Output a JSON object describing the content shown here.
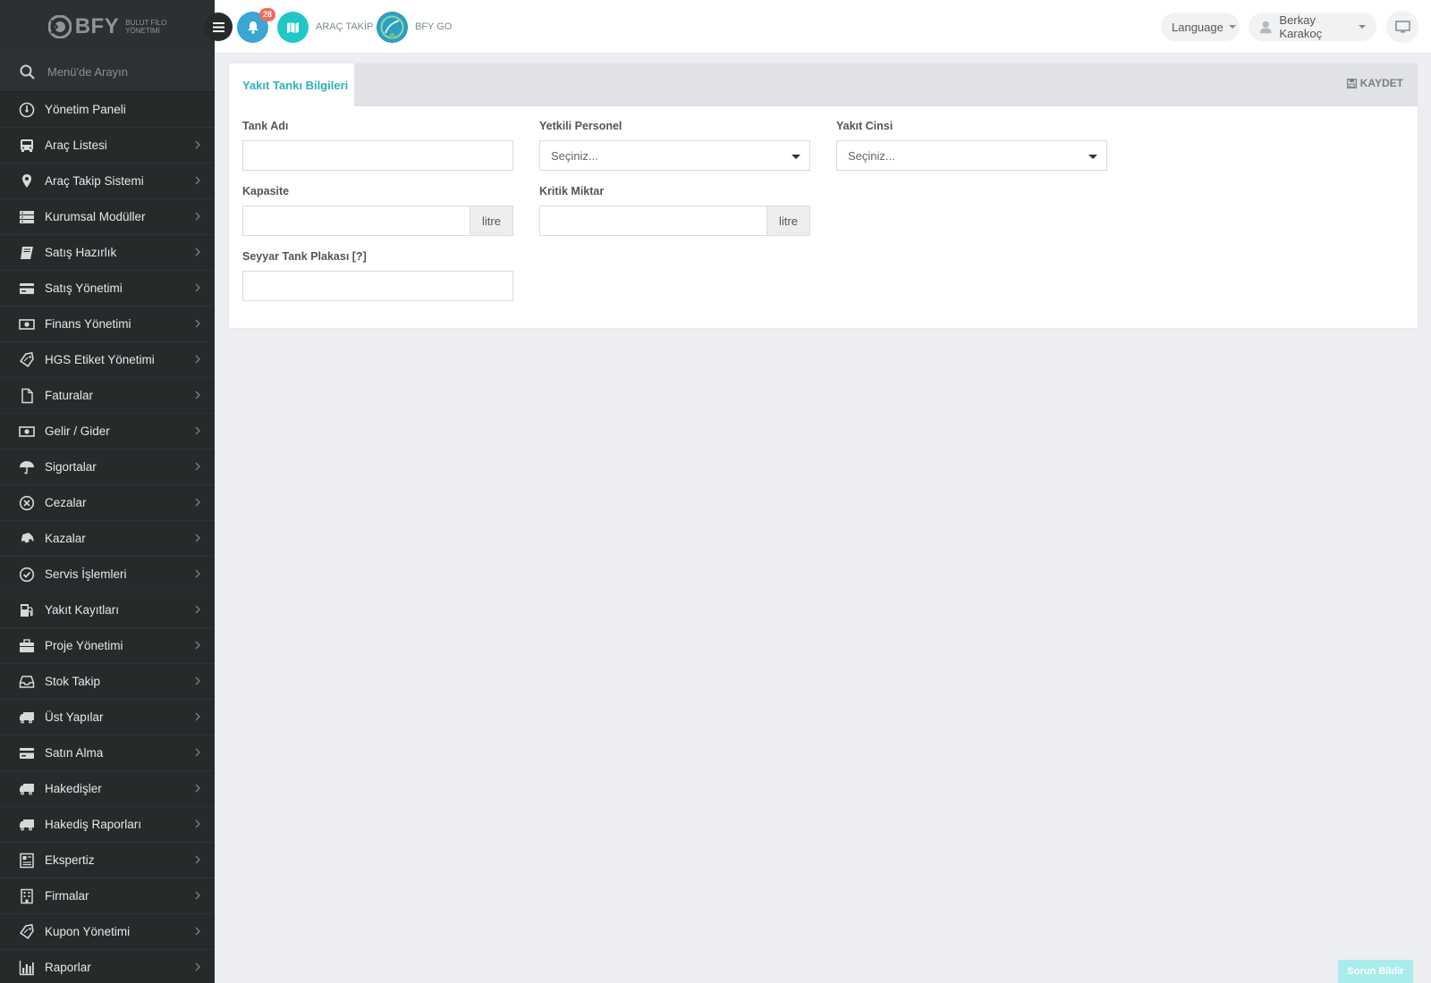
{
  "brand": {
    "name": "BFY",
    "subtitle_line1": "BULUT FİLO",
    "subtitle_line2": "YÖNETİMİ"
  },
  "sidebar": {
    "search_placeholder": "Menü'de Arayın",
    "items": [
      {
        "label": "Yönetim Paneli",
        "icon": "dashboard-icon",
        "chevron": false
      },
      {
        "label": "Araç Listesi",
        "icon": "bus-icon",
        "chevron": true
      },
      {
        "label": "Araç Takip Sistemi",
        "icon": "map-pin-icon",
        "chevron": true
      },
      {
        "label": "Kurumsal Modüller",
        "icon": "server-icon",
        "chevron": true
      },
      {
        "label": "Satış Hazırlık",
        "icon": "book-icon",
        "chevron": true
      },
      {
        "label": "Satış Yönetimi",
        "icon": "card-icon",
        "chevron": true
      },
      {
        "label": "Finans Yönetimi",
        "icon": "money-icon",
        "chevron": true
      },
      {
        "label": "HGS Etiket Yönetimi",
        "icon": "tag-icon",
        "chevron": true
      },
      {
        "label": "Faturalar",
        "icon": "file-icon",
        "chevron": true
      },
      {
        "label": "Gelir / Gider",
        "icon": "money-icon",
        "chevron": true
      },
      {
        "label": "Sigortalar",
        "icon": "umbrella-icon",
        "chevron": true
      },
      {
        "label": "Cezalar",
        "icon": "x-circle-icon",
        "chevron": true
      },
      {
        "label": "Kazalar",
        "icon": "car-crash-icon",
        "chevron": true
      },
      {
        "label": "Servis İşlemleri",
        "icon": "check-circle-icon",
        "chevron": true
      },
      {
        "label": "Yakıt Kayıtları",
        "icon": "fuel-pump-icon",
        "chevron": true
      },
      {
        "label": "Proje Yönetimi",
        "icon": "briefcase-icon",
        "chevron": true
      },
      {
        "label": "Stok Takip",
        "icon": "inbox-icon",
        "chevron": true
      },
      {
        "label": "Üst Yapılar",
        "icon": "truck-icon",
        "chevron": true
      },
      {
        "label": "Satın Alma",
        "icon": "card-icon",
        "chevron": true
      },
      {
        "label": "Hakedişler",
        "icon": "truck-icon",
        "chevron": true
      },
      {
        "label": "Hakediş Raporları",
        "icon": "truck-icon",
        "chevron": true
      },
      {
        "label": "Ekspertiz",
        "icon": "report-icon",
        "chevron": true
      },
      {
        "label": "Firmalar",
        "icon": "building-icon",
        "chevron": true
      },
      {
        "label": "Kupon Yönetimi",
        "icon": "tag-icon",
        "chevron": true
      },
      {
        "label": "Raporlar",
        "icon": "bar-chart-icon",
        "chevron": true
      }
    ]
  },
  "topbar": {
    "notification_count": "28",
    "arac_takip_label": "ARAÇ TAKİP",
    "bfy_go_label": "BFY GO",
    "language_label": "Language",
    "user_name": "Berkay Karakoç"
  },
  "panel": {
    "tab_label": "Yakıt Tankı Bilgileri",
    "save_label": "KAYDET",
    "fields": {
      "tank_name_label": "Tank Adı",
      "tank_name_value": "",
      "personnel_label": "Yetkili Personel",
      "personnel_value": "Seçiniz...",
      "fuel_type_label": "Yakıt Cinsi",
      "fuel_type_value": "Seçiniz...",
      "capacity_label": "Kapasite",
      "capacity_value": "",
      "capacity_unit": "litre",
      "critical_label": "Kritik Miktar",
      "critical_value": "",
      "critical_unit": "litre",
      "plate_label": "Seyyar Tank Plakası [?]",
      "plate_value": ""
    }
  },
  "footer": {
    "report_button": "Sorun Bildir"
  },
  "colors": {
    "accent": "#2fb3b5",
    "sidebar_bg": "#252a2b",
    "badge": "#f36a5a",
    "bell_btn": "#3ba6d4",
    "map_btn": "#1fc8c8"
  }
}
